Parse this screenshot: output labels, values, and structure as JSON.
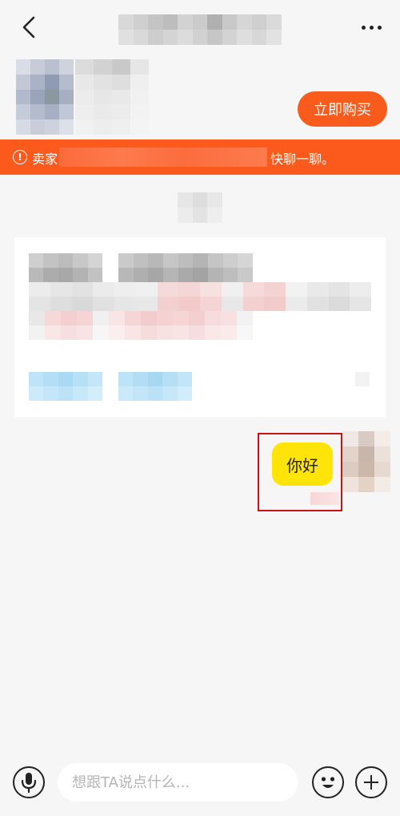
{
  "header": {
    "back_icon": "chevron-left-icon",
    "more_icon": "more-dots-icon"
  },
  "product": {
    "buy_label": "立即购买"
  },
  "notice": {
    "prefix": "卖家",
    "suffix": "快聊一聊。",
    "icon": "alert-circle-icon"
  },
  "messages": [
    {
      "from": "me",
      "text": "你好"
    }
  ],
  "bottom_bar": {
    "input_placeholder": "想跟TA说点什么...",
    "voice_icon": "microphone-icon",
    "emoji_icon": "emoji-icon",
    "plus_icon": "plus-icon"
  },
  "colors": {
    "accent_orange": "#f95b1d",
    "notice_bg": "#fb5a1c",
    "bubble_yellow": "#ffe40a",
    "highlight_red": "#c8131b",
    "page_bg": "#f6f6f6"
  }
}
